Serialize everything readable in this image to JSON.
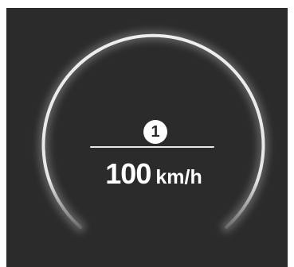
{
  "display": {
    "marker_label": "1",
    "speed_value": "100",
    "speed_unit": "km/h"
  },
  "colors": {
    "background": "#2b2b2b",
    "arc": "#eeeeee",
    "text": "#ffffff"
  }
}
